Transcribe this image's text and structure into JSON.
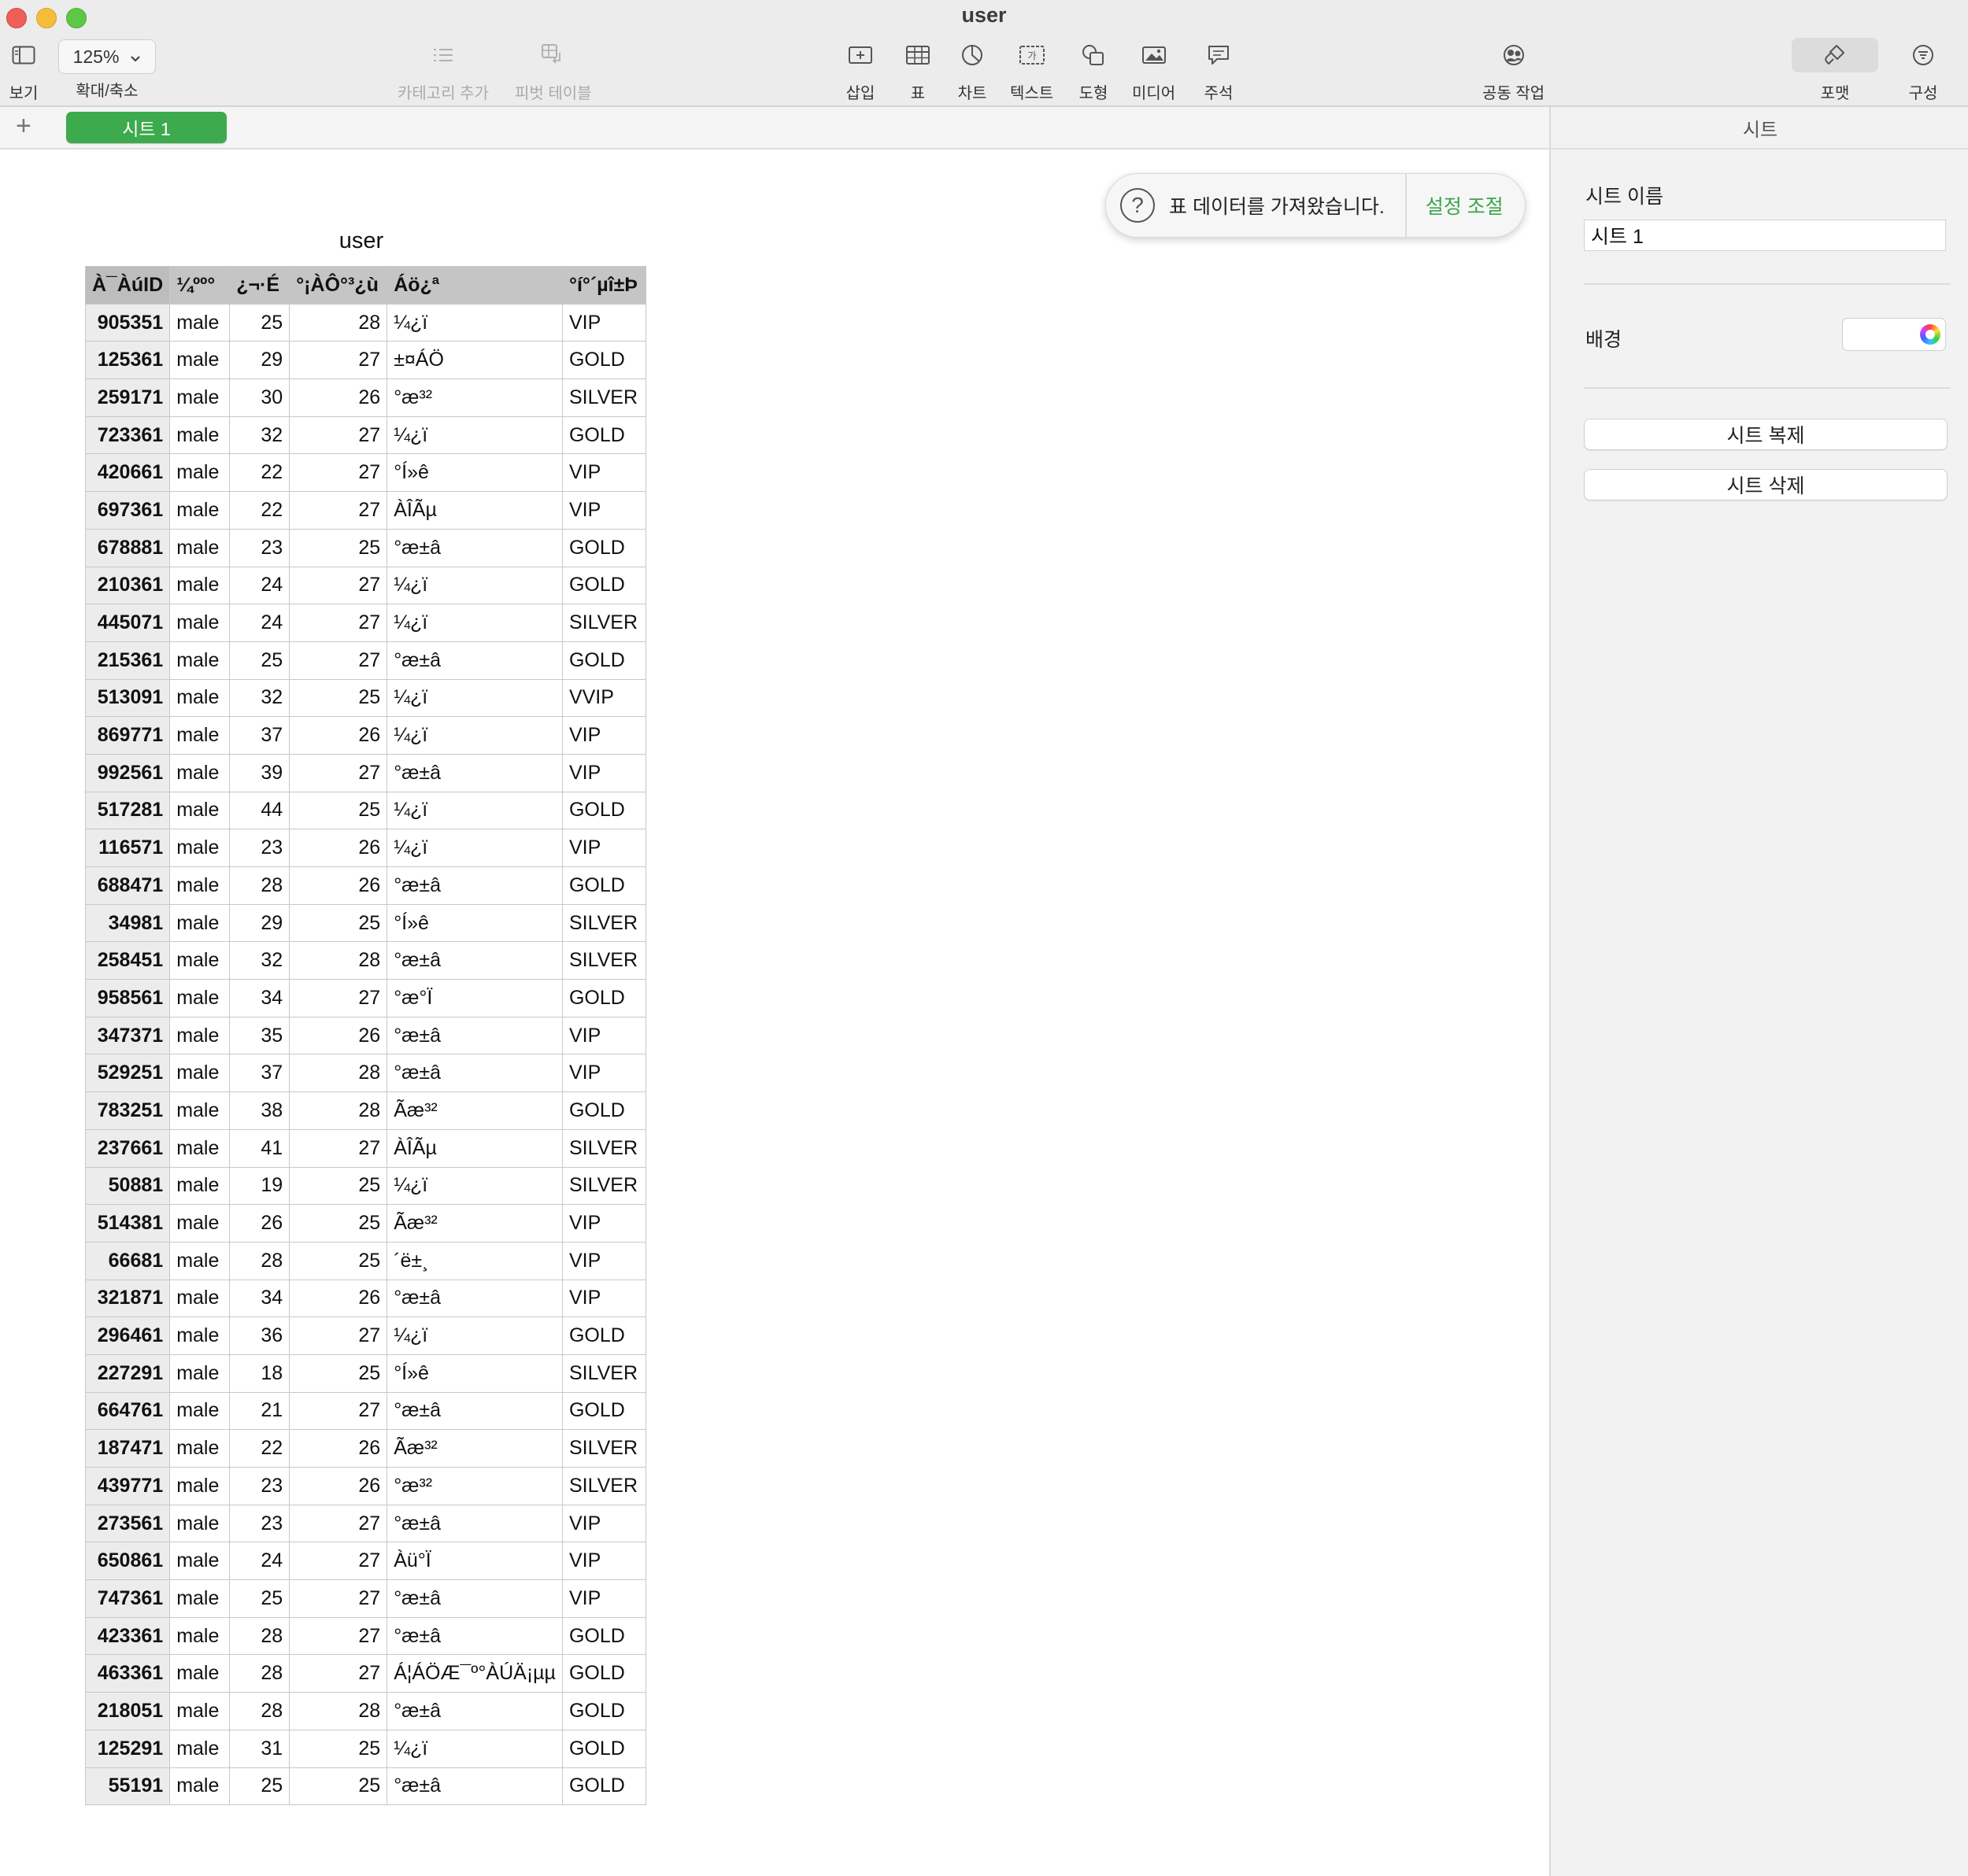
{
  "window": {
    "title": "user"
  },
  "toolbar": {
    "view_label": "보기",
    "zoom_value": "125%",
    "zoom_label": "확대/축소",
    "add_category_label": "카테고리 추가",
    "pivot_table_label": "피벗 테이블",
    "insert_label": "삽입",
    "table_label": "표",
    "chart_label": "차트",
    "text_label": "텍스트",
    "shape_label": "도형",
    "media_label": "미디어",
    "comment_label": "주석",
    "collaborate_label": "공동 작업",
    "format_label": "포맷",
    "organize_label": "구성"
  },
  "tabs": {
    "add_symbol": "+",
    "sheet_tab_label": "시트 1"
  },
  "toast": {
    "icon_symbol": "?",
    "message": "표 데이터를 가져왔습니다.",
    "action_label": "설정 조절"
  },
  "table": {
    "title": "user",
    "headers": [
      "À¯ÀúID",
      "¼ºº°",
      "¿¬·É",
      "°¡ÀÔ°³¿ù",
      "Áö¿ª",
      "°í°´µî±Þ"
    ],
    "rows": [
      [
        "905351",
        "male",
        "25",
        "28",
        "¼¿ï",
        "VIP"
      ],
      [
        "125361",
        "male",
        "29",
        "27",
        "±¤ÁÖ",
        "GOLD"
      ],
      [
        "259171",
        "male",
        "30",
        "26",
        "°æ³²",
        "SILVER"
      ],
      [
        "723361",
        "male",
        "32",
        "27",
        "¼¿ï",
        "GOLD"
      ],
      [
        "420661",
        "male",
        "22",
        "27",
        "°Í»ê",
        "VIP"
      ],
      [
        "697361",
        "male",
        "22",
        "27",
        "ÀÎÃµ",
        "VIP"
      ],
      [
        "678881",
        "male",
        "23",
        "25",
        "°æ±â",
        "GOLD"
      ],
      [
        "210361",
        "male",
        "24",
        "27",
        "¼¿ï",
        "GOLD"
      ],
      [
        "445071",
        "male",
        "24",
        "27",
        "¼¿ï",
        "SILVER"
      ],
      [
        "215361",
        "male",
        "25",
        "27",
        "°æ±â",
        "GOLD"
      ],
      [
        "513091",
        "male",
        "32",
        "25",
        "¼¿ï",
        "VVIP"
      ],
      [
        "869771",
        "male",
        "37",
        "26",
        "¼¿ï",
        "VIP"
      ],
      [
        "992561",
        "male",
        "39",
        "27",
        "°æ±â",
        "VIP"
      ],
      [
        "517281",
        "male",
        "44",
        "25",
        "¼¿ï",
        "GOLD"
      ],
      [
        "116571",
        "male",
        "23",
        "26",
        "¼¿ï",
        "VIP"
      ],
      [
        "688471",
        "male",
        "28",
        "26",
        "°æ±â",
        "GOLD"
      ],
      [
        "34981",
        "male",
        "29",
        "25",
        "°Í»ê",
        "SILVER"
      ],
      [
        "258451",
        "male",
        "32",
        "28",
        "°æ±â",
        "SILVER"
      ],
      [
        "958561",
        "male",
        "34",
        "27",
        "°æ°Ï",
        "GOLD"
      ],
      [
        "347371",
        "male",
        "35",
        "26",
        "°æ±â",
        "VIP"
      ],
      [
        "529251",
        "male",
        "37",
        "28",
        "°æ±â",
        "VIP"
      ],
      [
        "783251",
        "male",
        "38",
        "28",
        "Ãæ³²",
        "GOLD"
      ],
      [
        "237661",
        "male",
        "41",
        "27",
        "ÀÎÃµ",
        "SILVER"
      ],
      [
        "50881",
        "male",
        "19",
        "25",
        "¼¿ï",
        "SILVER"
      ],
      [
        "514381",
        "male",
        "26",
        "25",
        "Ãæ³²",
        "VIP"
      ],
      [
        "66681",
        "male",
        "28",
        "25",
        "´ë±¸",
        "VIP"
      ],
      [
        "321871",
        "male",
        "34",
        "26",
        "°æ±â",
        "VIP"
      ],
      [
        "296461",
        "male",
        "36",
        "27",
        "¼¿ï",
        "GOLD"
      ],
      [
        "227291",
        "male",
        "18",
        "25",
        "°Í»ê",
        "SILVER"
      ],
      [
        "664761",
        "male",
        "21",
        "27",
        "°æ±â",
        "GOLD"
      ],
      [
        "187471",
        "male",
        "22",
        "26",
        "Ãæ³²",
        "SILVER"
      ],
      [
        "439771",
        "male",
        "23",
        "26",
        "°æ³²",
        "SILVER"
      ],
      [
        "273561",
        "male",
        "23",
        "27",
        "°æ±â",
        "VIP"
      ],
      [
        "650861",
        "male",
        "24",
        "27",
        "Àü°Ï",
        "VIP"
      ],
      [
        "747361",
        "male",
        "25",
        "27",
        "°æ±â",
        "VIP"
      ],
      [
        "423361",
        "male",
        "28",
        "27",
        "°æ±â",
        "GOLD"
      ],
      [
        "463361",
        "male",
        "28",
        "27",
        "Á¦ÁÖÆ¯º°ÀÚÄ¡µµ",
        "GOLD"
      ],
      [
        "218051",
        "male",
        "28",
        "28",
        "°æ±â",
        "GOLD"
      ],
      [
        "125291",
        "male",
        "31",
        "25",
        "¼¿ï",
        "GOLD"
      ],
      [
        "55191",
        "male",
        "25",
        "25",
        "°æ±â",
        "GOLD"
      ]
    ]
  },
  "panel": {
    "header": "시트",
    "sheet_name_label": "시트 이름",
    "sheet_name_value": "시트 1",
    "background_label": "배경",
    "duplicate_button": "시트 복제",
    "delete_button": "시트 삭제"
  }
}
